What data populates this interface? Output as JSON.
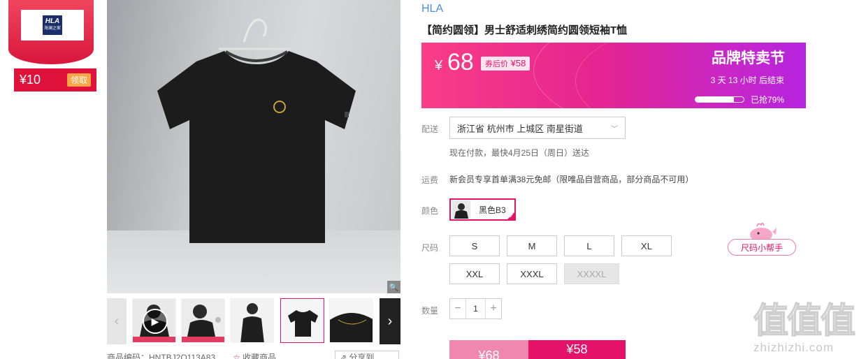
{
  "coupon": {
    "logo_text": "HLA",
    "logo_sub": "海澜之家",
    "amount": "¥10",
    "claim_label": "领取"
  },
  "gallery": {
    "prev_icon": "‹",
    "next_icon": "›",
    "zoom_icon": "🔍",
    "play_icon": "▶"
  },
  "meta": {
    "product_code": "商品编码：HNTBJ2Q113A83",
    "favorite": "收藏商品",
    "share": "分享到"
  },
  "product": {
    "brand": "HLA",
    "title": "【简约圆领】男士舒适刺绣简约圆领短袖T恤"
  },
  "promo": {
    "currency": "¥",
    "price": "68",
    "after_coupon_label": "券后价",
    "after_coupon_price": "¥58",
    "event_title": "品牌特卖节",
    "countdown": "3 天 13 小时 后结束",
    "sold_percent": 79,
    "sold_label": "已抢79%",
    "accent": "#e5126a"
  },
  "delivery": {
    "label": "配送",
    "location": "浙江省 杭州市 上城区 南星街道",
    "note": "现在付款，最快4月25日（周日）送达"
  },
  "shipping": {
    "label": "运费",
    "text": "新会员专享首单满38元免邮（限唯品自营商品，部分商品不可用）"
  },
  "color": {
    "label": "颜色",
    "selected": "黑色B3"
  },
  "size": {
    "label": "尺码",
    "options": [
      "S",
      "M",
      "L",
      "XL",
      "XXL",
      "XXXL",
      "XXXXL"
    ],
    "disabled": [
      "XXXXL"
    ],
    "helper_label": "尺码小帮手"
  },
  "quantity": {
    "label": "数量",
    "value": "1",
    "minus": "−",
    "plus": "+"
  },
  "buy": {
    "original": "¥68",
    "current": "¥58"
  },
  "watermark": {
    "chars": "值值值",
    "url": "zhizhizhi.com"
  }
}
